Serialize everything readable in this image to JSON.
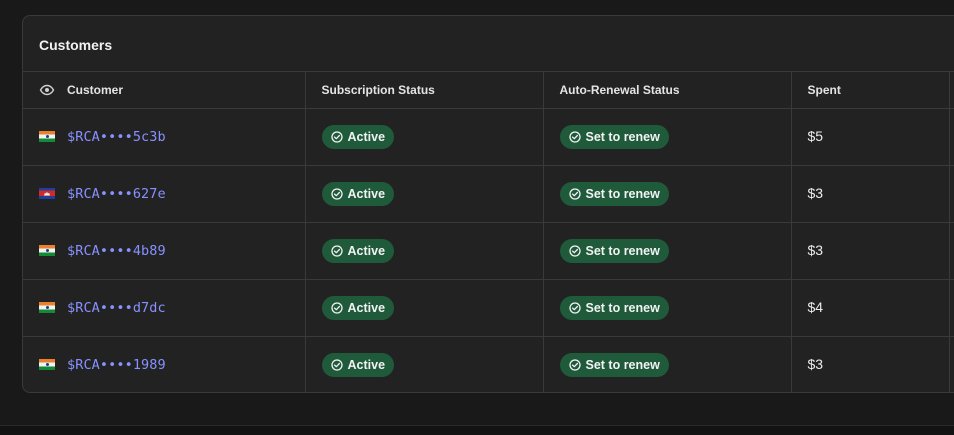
{
  "card": {
    "title": "Customers"
  },
  "table": {
    "columns": [
      "Customer",
      "Subscription Status",
      "Auto-Renewal Status",
      "Spent",
      ""
    ],
    "rows": [
      {
        "flag": "india-flag-icon",
        "customer": "$RCA••••5c3b",
        "subscription": "Active",
        "renewal": "Set to renew",
        "spent": "$5"
      },
      {
        "flag": "cambodia-flag-icon",
        "customer": "$RCA••••627e",
        "subscription": "Active",
        "renewal": "Set to renew",
        "spent": "$3"
      },
      {
        "flag": "india-flag-icon",
        "customer": "$RCA••••4b89",
        "subscription": "Active",
        "renewal": "Set to renew",
        "spent": "$3"
      },
      {
        "flag": "india-flag-icon",
        "customer": "$RCA••••d7dc",
        "subscription": "Active",
        "renewal": "Set to renew",
        "spent": "$4"
      },
      {
        "flag": "india-flag-icon",
        "customer": "$RCA••••1989",
        "subscription": "Active",
        "renewal": "Set to renew",
        "spent": "$3"
      }
    ]
  },
  "icons": {
    "column_toggle": "eye-icon",
    "status": "check-circle-icon"
  },
  "colors": {
    "background": "#191919",
    "card": "#222222",
    "border": "#3a3a3a",
    "link": "#8791ff",
    "badge_bg": "#1f5a3b"
  }
}
